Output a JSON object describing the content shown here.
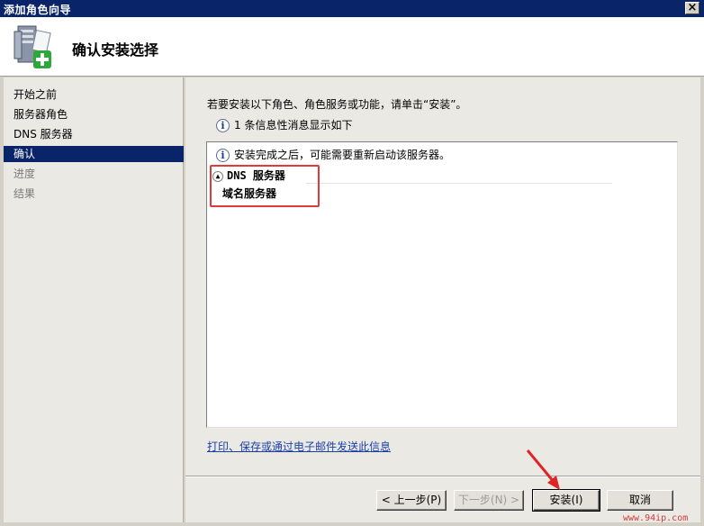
{
  "window": {
    "title": "添加角色向导",
    "close_label": "×"
  },
  "header": {
    "title": "确认安装选择",
    "icon": "server-add-icon"
  },
  "sidebar": {
    "items": [
      {
        "label": "开始之前",
        "state": "normal"
      },
      {
        "label": "服务器角色",
        "state": "normal"
      },
      {
        "label": "DNS 服务器",
        "state": "normal"
      },
      {
        "label": "确认",
        "state": "active"
      },
      {
        "label": "进度",
        "state": "disabled"
      },
      {
        "label": "结果",
        "state": "disabled"
      }
    ]
  },
  "main": {
    "intro": "若要安装以下角色、角色服务或功能，请单击“安装”。",
    "info_message": "1 条信息性消息显示如下",
    "list": {
      "note": "安装完成之后，可能需要重新启动该服务器。",
      "section_title": "DNS 服务器",
      "section_item": "域名服务器"
    },
    "link": "打印、保存或通过电子邮件发送此信息"
  },
  "footer": {
    "prev_label": "< 上一步(P)",
    "next_label": "下一步(N) >",
    "install_label": "安装(I)",
    "cancel_label": "取消"
  },
  "watermark": "www.94ip.com",
  "colors": {
    "titlebar": "#0a246a",
    "active_nav": "#0a246a",
    "highlight_box": "#e23a3a",
    "link": "#1a3fa8"
  }
}
